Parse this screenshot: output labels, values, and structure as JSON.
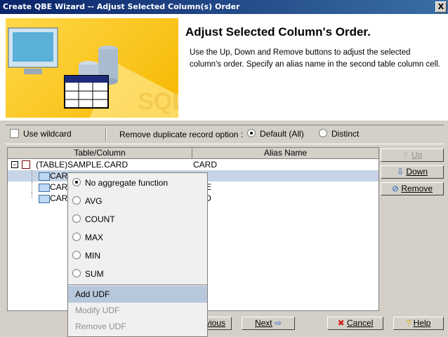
{
  "window": {
    "title": "Create QBE Wizard -- Adjust Selected Column(s) Order",
    "close_label": "X"
  },
  "banner": {
    "heading": "Adjust Selected Column's Order.",
    "description": "Use the Up, Down and Remove buttons to adjust the selected column's order. Specify an alias name in the second table column cell."
  },
  "options": {
    "wildcard_label": "Use wildcard",
    "duplicate_label": "Remove duplicate record option :",
    "default_label": "Default (All)",
    "distinct_label": "Distinct"
  },
  "table": {
    "headers": [
      "Table/Column",
      "Alias Name"
    ],
    "rows": [
      {
        "name": "(TABLE)SAMPLE.CARD",
        "alias": "CARD"
      },
      {
        "name": "CAR",
        "alias": ""
      },
      {
        "name": "CAR",
        "alias": "AME"
      },
      {
        "name": "CAR",
        "alias": "OTO"
      }
    ]
  },
  "side_buttons": {
    "up": "Up",
    "down": "Down",
    "remove": "Remove"
  },
  "popup": {
    "items": [
      "No aggregate function",
      "AVG",
      "COUNT",
      "MAX",
      "MIN",
      "SUM"
    ],
    "udf": [
      "Add UDF",
      "Modify UDF",
      "Remove UDF"
    ]
  },
  "footer": {
    "previous": "vious",
    "next": "Next",
    "cancel": "Cancel",
    "help": "Help"
  },
  "colors": {
    "title_bar": "#0a246a",
    "banner_yellow": "#f6b800",
    "selection": "#c7d4e6"
  }
}
